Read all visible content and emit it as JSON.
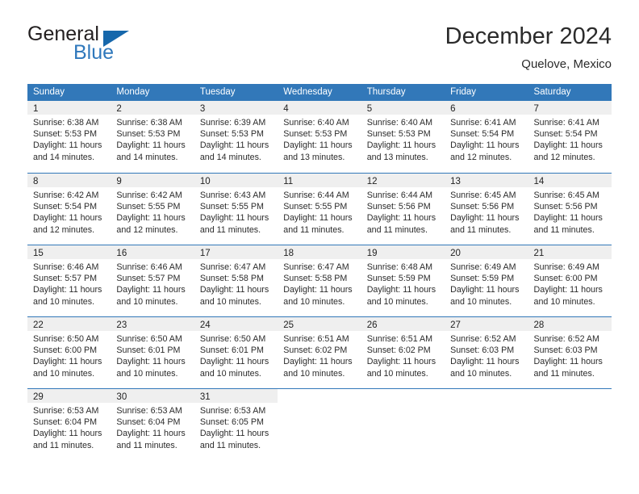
{
  "brand": {
    "name_part1": "General",
    "name_part2": "Blue",
    "accent_color": "#2f78bc",
    "triangle_color": "#1667ab"
  },
  "header": {
    "title": "December 2024",
    "subtitle": "Quelove, Mexico"
  },
  "theme": {
    "header_blue": "#3278b9",
    "daynum_gray": "#efefef",
    "text_color": "#2b2b2b"
  },
  "calendar": {
    "weekdays": [
      "Sunday",
      "Monday",
      "Tuesday",
      "Wednesday",
      "Thursday",
      "Friday",
      "Saturday"
    ],
    "weeks": [
      [
        {
          "day": "1",
          "lines": [
            "Sunrise: 6:38 AM",
            "Sunset: 5:53 PM",
            "Daylight: 11 hours",
            "and 14 minutes."
          ]
        },
        {
          "day": "2",
          "lines": [
            "Sunrise: 6:38 AM",
            "Sunset: 5:53 PM",
            "Daylight: 11 hours",
            "and 14 minutes."
          ]
        },
        {
          "day": "3",
          "lines": [
            "Sunrise: 6:39 AM",
            "Sunset: 5:53 PM",
            "Daylight: 11 hours",
            "and 14 minutes."
          ]
        },
        {
          "day": "4",
          "lines": [
            "Sunrise: 6:40 AM",
            "Sunset: 5:53 PM",
            "Daylight: 11 hours",
            "and 13 minutes."
          ]
        },
        {
          "day": "5",
          "lines": [
            "Sunrise: 6:40 AM",
            "Sunset: 5:53 PM",
            "Daylight: 11 hours",
            "and 13 minutes."
          ]
        },
        {
          "day": "6",
          "lines": [
            "Sunrise: 6:41 AM",
            "Sunset: 5:54 PM",
            "Daylight: 11 hours",
            "and 12 minutes."
          ]
        },
        {
          "day": "7",
          "lines": [
            "Sunrise: 6:41 AM",
            "Sunset: 5:54 PM",
            "Daylight: 11 hours",
            "and 12 minutes."
          ]
        }
      ],
      [
        {
          "day": "8",
          "lines": [
            "Sunrise: 6:42 AM",
            "Sunset: 5:54 PM",
            "Daylight: 11 hours",
            "and 12 minutes."
          ]
        },
        {
          "day": "9",
          "lines": [
            "Sunrise: 6:42 AM",
            "Sunset: 5:55 PM",
            "Daylight: 11 hours",
            "and 12 minutes."
          ]
        },
        {
          "day": "10",
          "lines": [
            "Sunrise: 6:43 AM",
            "Sunset: 5:55 PM",
            "Daylight: 11 hours",
            "and 11 minutes."
          ]
        },
        {
          "day": "11",
          "lines": [
            "Sunrise: 6:44 AM",
            "Sunset: 5:55 PM",
            "Daylight: 11 hours",
            "and 11 minutes."
          ]
        },
        {
          "day": "12",
          "lines": [
            "Sunrise: 6:44 AM",
            "Sunset: 5:56 PM",
            "Daylight: 11 hours",
            "and 11 minutes."
          ]
        },
        {
          "day": "13",
          "lines": [
            "Sunrise: 6:45 AM",
            "Sunset: 5:56 PM",
            "Daylight: 11 hours",
            "and 11 minutes."
          ]
        },
        {
          "day": "14",
          "lines": [
            "Sunrise: 6:45 AM",
            "Sunset: 5:56 PM",
            "Daylight: 11 hours",
            "and 11 minutes."
          ]
        }
      ],
      [
        {
          "day": "15",
          "lines": [
            "Sunrise: 6:46 AM",
            "Sunset: 5:57 PM",
            "Daylight: 11 hours",
            "and 10 minutes."
          ]
        },
        {
          "day": "16",
          "lines": [
            "Sunrise: 6:46 AM",
            "Sunset: 5:57 PM",
            "Daylight: 11 hours",
            "and 10 minutes."
          ]
        },
        {
          "day": "17",
          "lines": [
            "Sunrise: 6:47 AM",
            "Sunset: 5:58 PM",
            "Daylight: 11 hours",
            "and 10 minutes."
          ]
        },
        {
          "day": "18",
          "lines": [
            "Sunrise: 6:47 AM",
            "Sunset: 5:58 PM",
            "Daylight: 11 hours",
            "and 10 minutes."
          ]
        },
        {
          "day": "19",
          "lines": [
            "Sunrise: 6:48 AM",
            "Sunset: 5:59 PM",
            "Daylight: 11 hours",
            "and 10 minutes."
          ]
        },
        {
          "day": "20",
          "lines": [
            "Sunrise: 6:49 AM",
            "Sunset: 5:59 PM",
            "Daylight: 11 hours",
            "and 10 minutes."
          ]
        },
        {
          "day": "21",
          "lines": [
            "Sunrise: 6:49 AM",
            "Sunset: 6:00 PM",
            "Daylight: 11 hours",
            "and 10 minutes."
          ]
        }
      ],
      [
        {
          "day": "22",
          "lines": [
            "Sunrise: 6:50 AM",
            "Sunset: 6:00 PM",
            "Daylight: 11 hours",
            "and 10 minutes."
          ]
        },
        {
          "day": "23",
          "lines": [
            "Sunrise: 6:50 AM",
            "Sunset: 6:01 PM",
            "Daylight: 11 hours",
            "and 10 minutes."
          ]
        },
        {
          "day": "24",
          "lines": [
            "Sunrise: 6:50 AM",
            "Sunset: 6:01 PM",
            "Daylight: 11 hours",
            "and 10 minutes."
          ]
        },
        {
          "day": "25",
          "lines": [
            "Sunrise: 6:51 AM",
            "Sunset: 6:02 PM",
            "Daylight: 11 hours",
            "and 10 minutes."
          ]
        },
        {
          "day": "26",
          "lines": [
            "Sunrise: 6:51 AM",
            "Sunset: 6:02 PM",
            "Daylight: 11 hours",
            "and 10 minutes."
          ]
        },
        {
          "day": "27",
          "lines": [
            "Sunrise: 6:52 AM",
            "Sunset: 6:03 PM",
            "Daylight: 11 hours",
            "and 10 minutes."
          ]
        },
        {
          "day": "28",
          "lines": [
            "Sunrise: 6:52 AM",
            "Sunset: 6:03 PM",
            "Daylight: 11 hours",
            "and 11 minutes."
          ]
        }
      ],
      [
        {
          "day": "29",
          "lines": [
            "Sunrise: 6:53 AM",
            "Sunset: 6:04 PM",
            "Daylight: 11 hours",
            "and 11 minutes."
          ]
        },
        {
          "day": "30",
          "lines": [
            "Sunrise: 6:53 AM",
            "Sunset: 6:04 PM",
            "Daylight: 11 hours",
            "and 11 minutes."
          ]
        },
        {
          "day": "31",
          "lines": [
            "Sunrise: 6:53 AM",
            "Sunset: 6:05 PM",
            "Daylight: 11 hours",
            "and 11 minutes."
          ]
        },
        {
          "day": "",
          "lines": []
        },
        {
          "day": "",
          "lines": []
        },
        {
          "day": "",
          "lines": []
        },
        {
          "day": "",
          "lines": []
        }
      ]
    ]
  }
}
